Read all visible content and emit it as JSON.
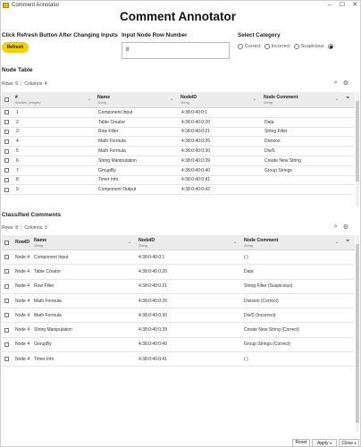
{
  "window": {
    "title": "Comment Annotator"
  },
  "page": {
    "title": "Comment Annotator"
  },
  "controls": {
    "refresh_hint": "Click Refresh Button After Changing Inputs",
    "refresh_label": "Refresh",
    "row_number_label": "Input Node Row Number",
    "row_number_value": "8",
    "category_label": "Select Category",
    "categories": [
      "Correct",
      "Incorrect",
      "Suspicious",
      ""
    ],
    "selected_category_index": 3
  },
  "node_table": {
    "title": "Node Table",
    "rows_label": "Rows: 9",
    "columns_label": "Columns: 4",
    "columns": [
      {
        "label": "#",
        "type": "Number (integer)"
      },
      {
        "label": "Name",
        "type": "String"
      },
      {
        "label": "NodeID",
        "type": "String"
      },
      {
        "label": "Node Comment",
        "type": "String"
      }
    ],
    "rows": [
      [
        "1",
        "Component Input",
        "4:38:0:40:0:1",
        ""
      ],
      [
        "2",
        "Table Creator",
        "4:38:0:40:0:20",
        "Data"
      ],
      [
        "3",
        "Row Filter",
        "4:38:0:40:0:21",
        "String Filter"
      ],
      [
        "4",
        "Math Formula",
        "4:38:0:40:0:26",
        "Division"
      ],
      [
        "5",
        "Math Formula",
        "4:38:0:40:0:30",
        "Div/0"
      ],
      [
        "6",
        "String Manipulation",
        "4:38:0:40:0:39",
        "Create New String"
      ],
      [
        "7",
        "GroupBy",
        "4:38:0:40:0:40",
        "Group Strings"
      ],
      [
        "8",
        "Timer Info",
        "4:38:0:40:0:41",
        ""
      ],
      [
        "9",
        "Component Output",
        "4:38:0:40:0:42",
        ""
      ]
    ]
  },
  "classified_table": {
    "title": "Classified Comments",
    "rows_label": "Rows: 8",
    "columns_label": "Columns: 3",
    "columns": [
      {
        "label": "RowID",
        "type": ""
      },
      {
        "label": "Name",
        "type": "String"
      },
      {
        "label": "NodeID",
        "type": "String"
      },
      {
        "label": "Node Comment",
        "type": "String"
      }
    ],
    "rows": [
      [
        "Node 4",
        "Component Input",
        "4:38:0:40:0:1",
        "( )"
      ],
      [
        "Node 4",
        "Table Creator",
        "4:38:0:40:0:20",
        "Data"
      ],
      [
        "Node 4",
        "Row Filter",
        "4:38:0:40:0:21",
        "String Filter (Suspicious)"
      ],
      [
        "Node 4",
        "Math Formula",
        "4:38:0:40:0:26",
        "Division (Correct)"
      ],
      [
        "Node 4",
        "Math Formula",
        "4:38:0:40:0:30",
        "Div/0 (Incorrect)"
      ],
      [
        "Node 4",
        "String Manipulation",
        "4:38:0:40:0:39",
        "Create New String (Correct)"
      ],
      [
        "Node 4",
        "GroupBy",
        "4:38:0:40:0:40",
        "Group Strings (Correct)"
      ],
      [
        "Node 4",
        "Timer Info",
        "4:38:0:40:0:41",
        "( )"
      ]
    ]
  },
  "footer": {
    "reset_label": "Reset",
    "apply_label": "Apply",
    "close_label": "Close"
  },
  "icons": {
    "search": "search-icon",
    "settings": "sliders-icon",
    "filter": "filter-icon",
    "chevron": "chevron-down-icon"
  },
  "colors": {
    "accent": "#f5d000",
    "header_bg": "#ececec"
  }
}
